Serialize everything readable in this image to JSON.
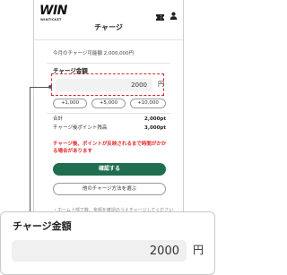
{
  "brand": {
    "logo_text": "WIN",
    "logo_subtext": "WINTICKET"
  },
  "header": {
    "title": "チャージ"
  },
  "icons": {
    "ticket": "ticket-icon",
    "user": "user-icon"
  },
  "available": {
    "text": "今月のチャージ可能額 2,000,000円"
  },
  "amount": {
    "heading": "チャージ金額",
    "value": "2000",
    "unit": "円"
  },
  "quick_amounts": [
    "+1,000",
    "+5,000",
    "+10,000"
  ],
  "summary": [
    {
      "label": "合計",
      "value": "2,000pt"
    },
    {
      "label": "チャージ後ポイント残高",
      "value": "3,000pt"
    }
  ],
  "warning": "チャージ後、ポイントが反映されるまで時間がかかる場合があります",
  "buttons": {
    "confirm": "確認する",
    "other_method": "他のチャージ方法を選ぶ"
  },
  "faded_note": "・ホーム上部で数、金額を確認のうえチャージしてください",
  "zoom": {
    "heading": "チャージ金額",
    "value": "2000",
    "unit": "円"
  },
  "colors": {
    "accent_green": "#1f6e4f",
    "warning_red": "#e32a2a",
    "highlight_red": "#d9252a"
  }
}
